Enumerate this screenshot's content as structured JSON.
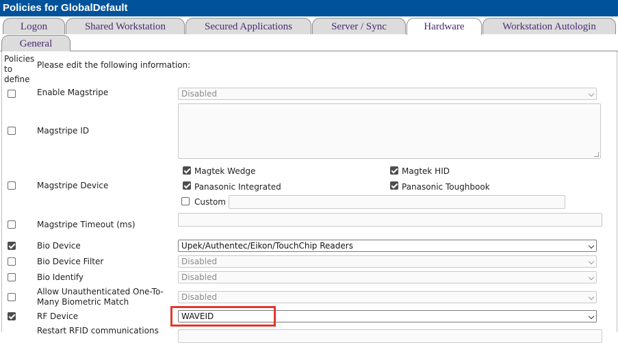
{
  "window": {
    "title": "Policies for GlobalDefault"
  },
  "tabs": [
    {
      "label": "Logon"
    },
    {
      "label": "Shared Workstation"
    },
    {
      "label": "Secured Applications"
    },
    {
      "label": "Server / Sync"
    },
    {
      "label": "Hardware"
    },
    {
      "label": "Workstation Autologin"
    },
    {
      "label": "General"
    }
  ],
  "header": {
    "policies_col": "Policies to define",
    "instructions": "Please edit the following information:"
  },
  "rows": [
    {
      "label": "Enable Magstripe",
      "checked": false,
      "value": "Disabled"
    },
    {
      "label": "Magstripe ID",
      "checked": false,
      "value": ""
    },
    {
      "label": "Magstripe Device",
      "checked": false,
      "options": [
        {
          "label": "Magtek Wedge",
          "checked": true
        },
        {
          "label": "Magtek HID",
          "checked": true
        },
        {
          "label": "Panasonic Integrated",
          "checked": true
        },
        {
          "label": "Panasonic Toughbook",
          "checked": true
        },
        {
          "label": "Custom",
          "checked": false,
          "value": ""
        }
      ]
    },
    {
      "label": "Magstripe Timeout (ms)",
      "checked": false,
      "value": ""
    },
    {
      "label": "Bio Device",
      "checked": true,
      "value": "Upek/Authentec/Eikon/TouchChip Readers"
    },
    {
      "label": "Bio Device Filter",
      "checked": false,
      "value": "Disabled"
    },
    {
      "label": "Bio Identify",
      "checked": false,
      "value": "Disabled"
    },
    {
      "label": "Allow Unauthenticated One-To-Many Biometric Match",
      "checked": false,
      "value": "Disabled"
    },
    {
      "label": "RF Device",
      "checked": true,
      "value": "WAVEID"
    },
    {
      "label": "Restart RFID communications",
      "checked": false,
      "value": ""
    }
  ],
  "colors": {
    "titlebar": "#00529b",
    "tab_text": "#4b2b73",
    "highlight": "#e0382b"
  }
}
